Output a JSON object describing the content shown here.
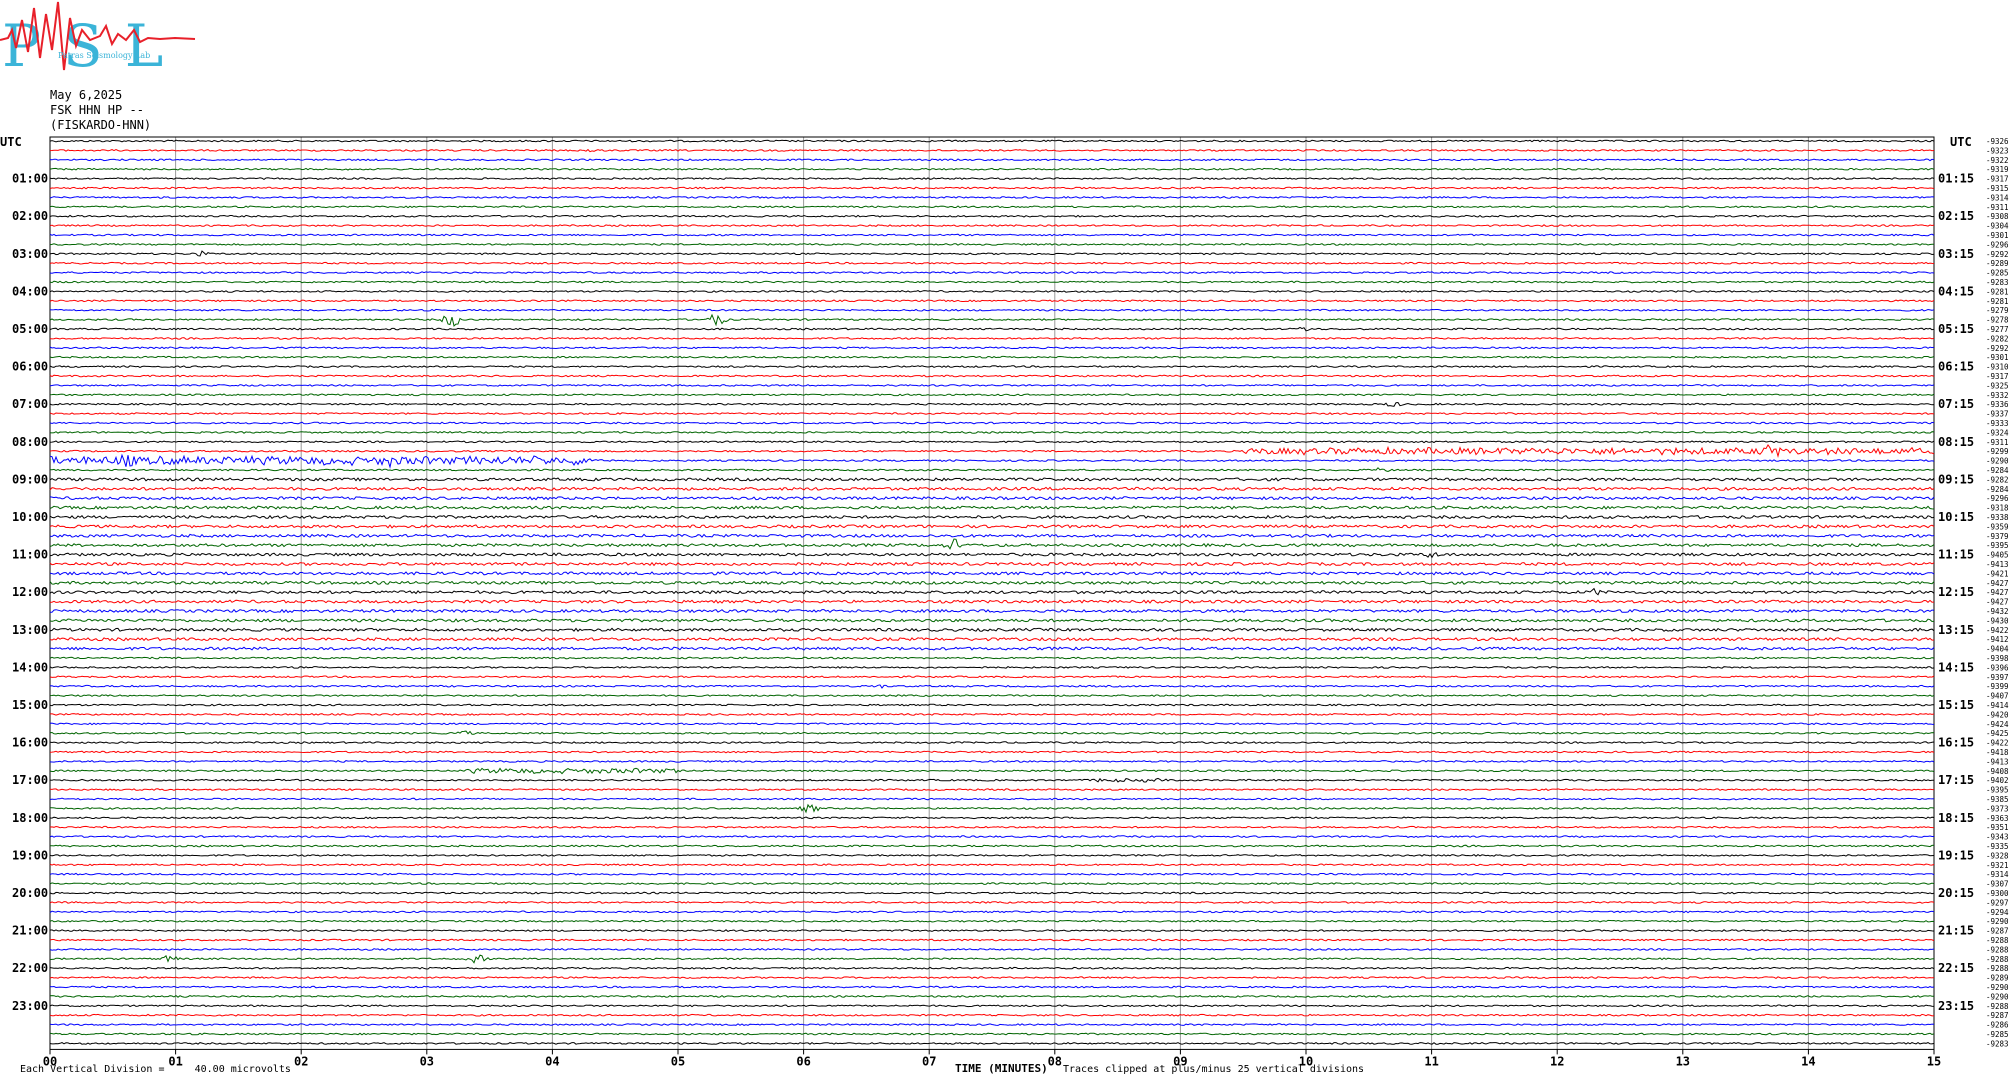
{
  "header": {
    "logo_text": "PSL",
    "logo_subtitle": "Patras Seismology Lab",
    "date": "May 6,2025",
    "channel": "FSK HHN HP --",
    "station": "(FISKARDO-HNN)"
  },
  "footer": {
    "scale_prefix": "Each Vertical Division =",
    "scale_value": "40.00 microvolts",
    "clip_note": "Traces clipped at plus/minus 25 vertical divisions"
  },
  "colors": {
    "black": "#000000",
    "red": "#ff0000",
    "blue": "#0000ff",
    "green": "#006400",
    "grid": "#9a9a9a"
  },
  "chart_data": {
    "type": "line",
    "title": "",
    "xlabel": "TIME (MINUTES)",
    "xlim": [
      0,
      15
    ],
    "x_ticks": [
      "00",
      "01",
      "02",
      "03",
      "04",
      "05",
      "06",
      "07",
      "08",
      "09",
      "10",
      "11",
      "12",
      "13",
      "14",
      "15"
    ],
    "left_axis_label": "UTC",
    "right_axis_label": "UTC",
    "left_hour_labels": [
      "01:00",
      "02:00",
      "03:00",
      "04:00",
      "05:00",
      "06:00",
      "07:00",
      "08:00",
      "09:00",
      "10:00",
      "11:00",
      "12:00",
      "13:00",
      "14:00",
      "15:00",
      "16:00",
      "17:00",
      "18:00",
      "19:00",
      "20:00",
      "21:00",
      "22:00",
      "23:00"
    ],
    "right_hour_labels": [
      "01:15",
      "02:15",
      "03:15",
      "04:15",
      "05:15",
      "06:15",
      "07:15",
      "08:15",
      "09:15",
      "10:15",
      "11:15",
      "12:15",
      "13:15",
      "14:15",
      "15:15",
      "16:15",
      "17:15",
      "18:15",
      "19:15",
      "20:15",
      "21:15",
      "22:15",
      "23:15"
    ],
    "trace_color_cycle": [
      "black",
      "red",
      "blue",
      "green"
    ],
    "trace_offsets": [
      "-9326",
      "-9323",
      "-9322",
      "-9319",
      "-9317",
      "-9315",
      "-9314",
      "-9311",
      "-9308",
      "-9304",
      "-9301",
      "-9296",
      "-9292",
      "-9289",
      "-9285",
      "-9283",
      "-9281",
      "-9281",
      "-9279",
      "-9278",
      "-9277",
      "-9282",
      "-9292",
      "-9301",
      "-9310",
      "-9317",
      "-9325",
      "-9332",
      "-9336",
      "-9337",
      "-9333",
      "-9324",
      "-9311",
      "-9299",
      "-9290",
      "-9284",
      "-9282",
      "-9284",
      "-9296",
      "-9318",
      "-9338",
      "-9359",
      "-9379",
      "-9395",
      "-9405",
      "-9413",
      "-9421",
      "-9427",
      "-9427",
      "-9427",
      "-9432",
      "-9430",
      "-9422",
      "-9412",
      "-9404",
      "-9398",
      "-9396",
      "-9397",
      "-9399",
      "-9407",
      "-9414",
      "-9420",
      "-9424",
      "-9425",
      "-9422",
      "-9418",
      "-9413",
      "-9408",
      "-9402",
      "-9395",
      "-9385",
      "-9373",
      "-9363",
      "-9351",
      "-9343",
      "-9335",
      "-9328",
      "-9321",
      "-9314",
      "-9307",
      "-9300",
      "-9297",
      "-9294",
      "-9290",
      "-9287",
      "-9288",
      "-9288",
      "-9288",
      "-9288",
      "-9289",
      "-9290",
      "-9290",
      "-9288",
      "-9287",
      "-9286",
      "-9285",
      "-9283"
    ],
    "events": [
      {
        "trace": 1,
        "minute": 4.3,
        "amp": 2.5
      },
      {
        "trace": 12,
        "minute": 1.2,
        "amp": 3
      },
      {
        "trace": 19,
        "minute": 3.2,
        "amp": 8
      },
      {
        "trace": 19,
        "minute": 5.3,
        "amp": 7
      },
      {
        "trace": 20,
        "minute": 10.0,
        "amp": 3
      },
      {
        "trace": 28,
        "minute": 10.7,
        "amp": 3
      },
      {
        "trace": 33,
        "minute": 13.7,
        "amp": 10
      },
      {
        "trace": 34,
        "minute": 0.6,
        "amp": 10
      },
      {
        "trace": 34,
        "minute": 2.7,
        "amp": 8
      },
      {
        "trace": 35,
        "minute": 10.6,
        "amp": 3
      },
      {
        "trace": 43,
        "minute": 7.2,
        "amp": 7
      },
      {
        "trace": 44,
        "minute": 11.0,
        "amp": 4
      },
      {
        "trace": 48,
        "minute": 12.3,
        "amp": 4
      },
      {
        "trace": 58,
        "minute": 6.6,
        "amp": 2.5
      },
      {
        "trace": 63,
        "minute": 3.3,
        "amp": 3
      },
      {
        "trace": 71,
        "minute": 6.05,
        "amp": 5
      },
      {
        "trace": 87,
        "minute": 0.95,
        "amp": 4
      },
      {
        "trace": 87,
        "minute": 3.4,
        "amp": 5
      }
    ],
    "noisy_bursts": [
      {
        "trace": 33,
        "from": 9.5,
        "to": 15.0,
        "amp": 4
      },
      {
        "trace": 34,
        "from": 0.0,
        "to": 4.4,
        "amp": 5
      },
      {
        "trace": 67,
        "from": 3.3,
        "to": 5.0,
        "amp": 3
      },
      {
        "trace": 68,
        "from": 8.3,
        "to": 8.9,
        "amp": 2
      }
    ],
    "noisy_range": [
      36,
      54
    ]
  }
}
